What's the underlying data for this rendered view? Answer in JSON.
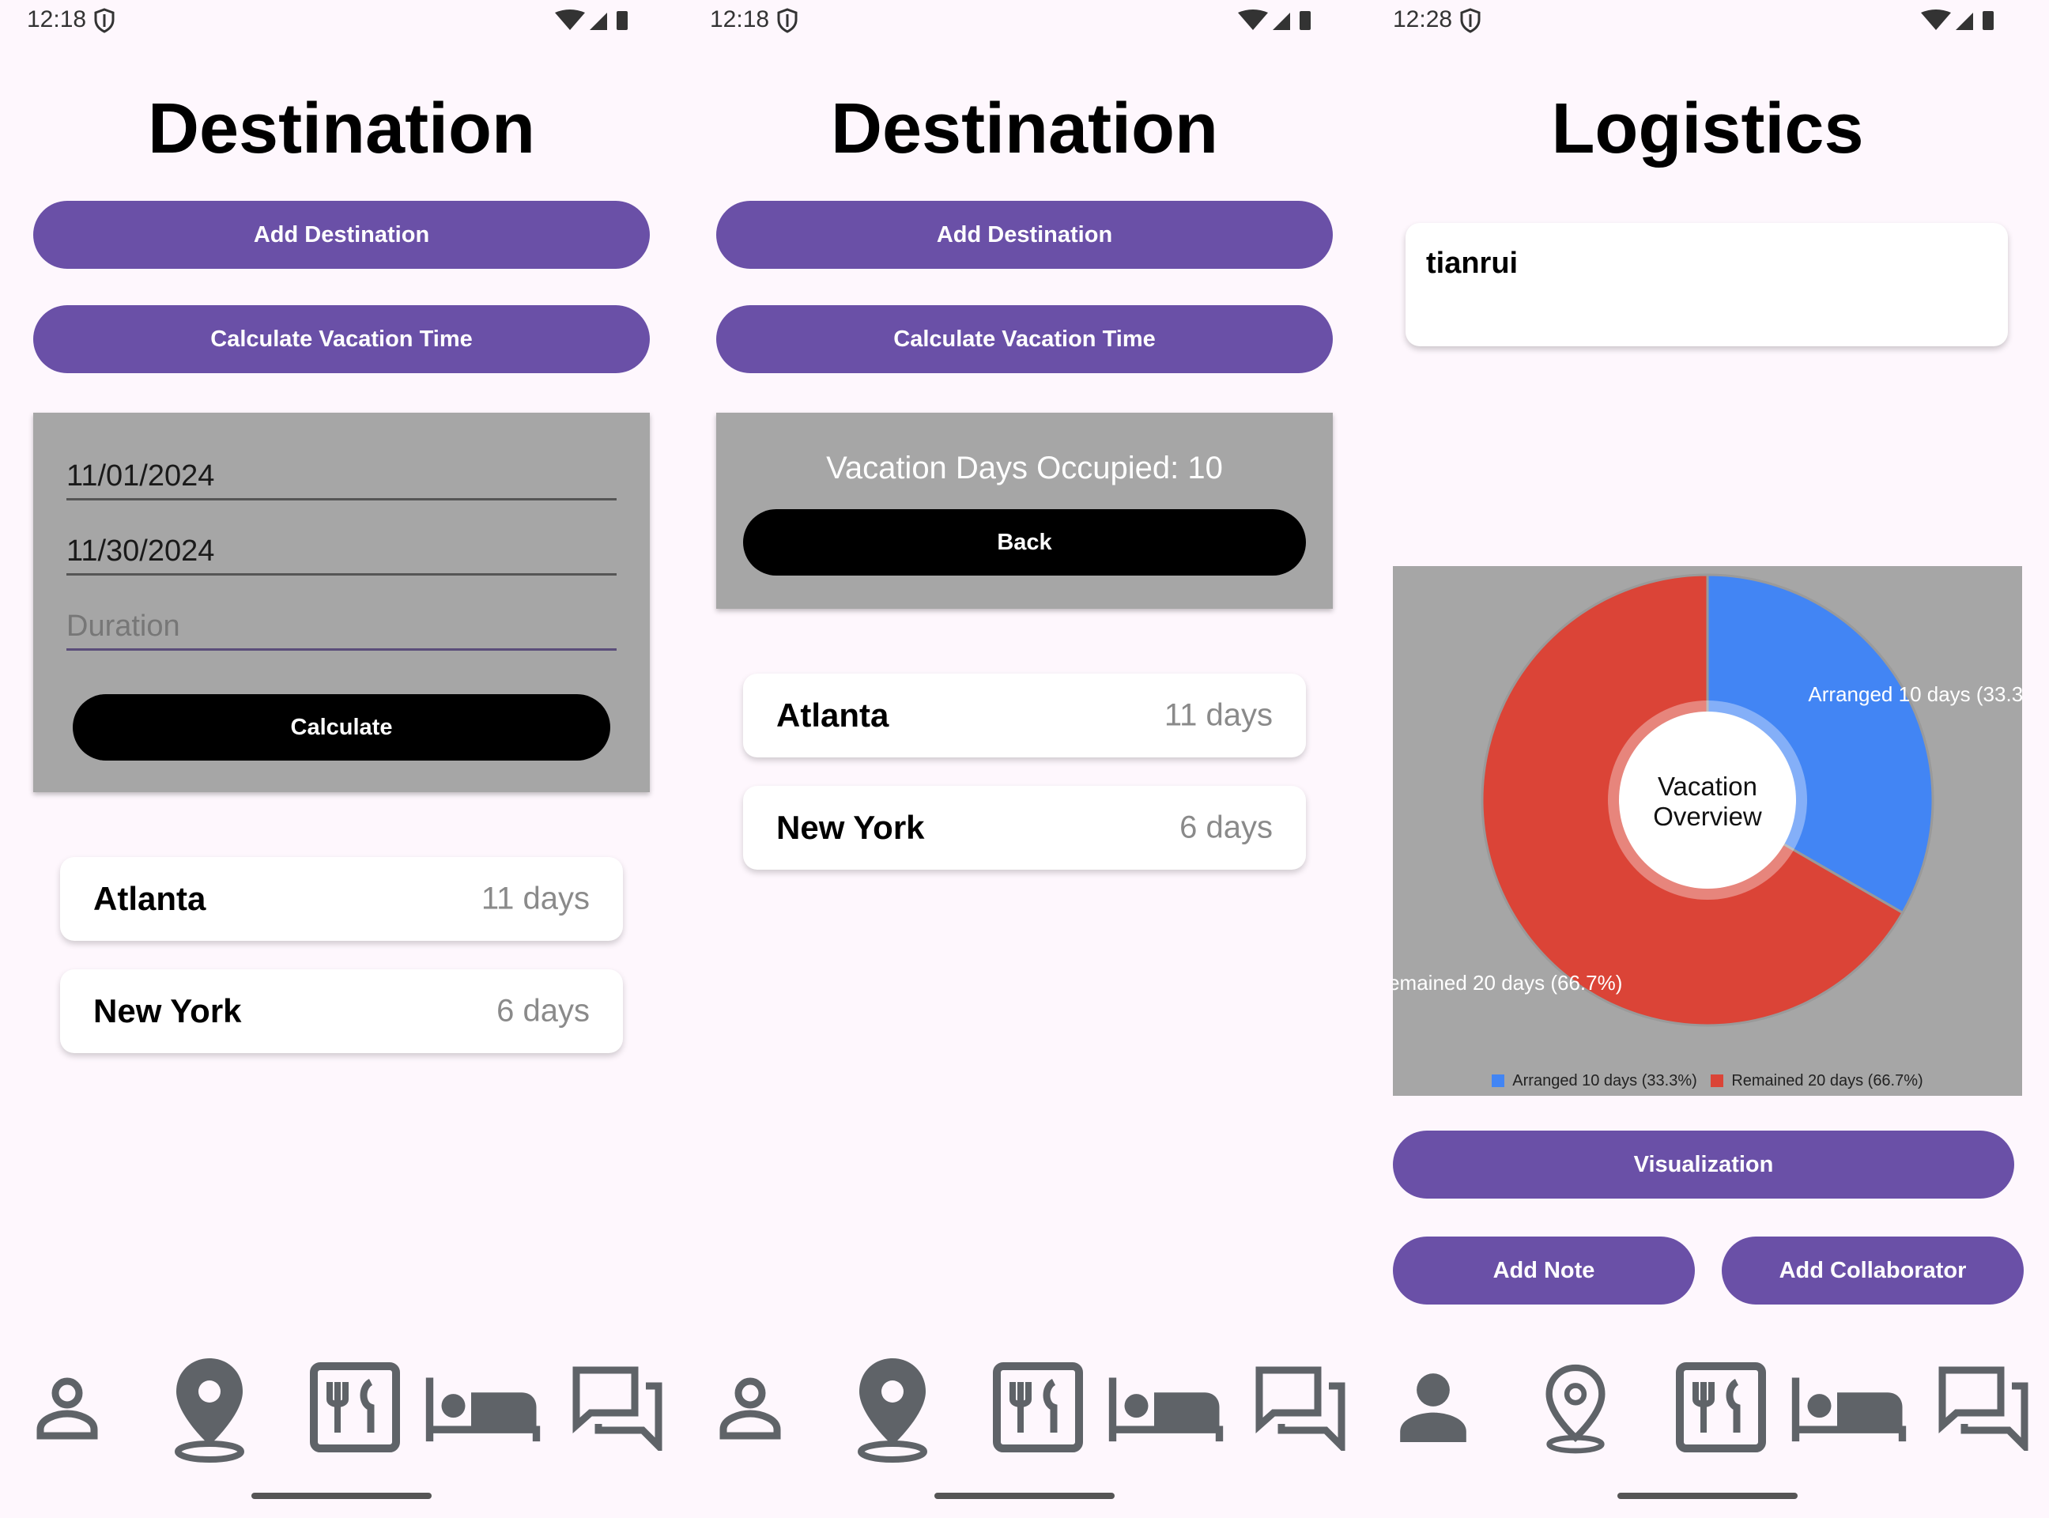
{
  "panels": [
    {
      "status": {
        "time": "12:18"
      },
      "title": "Destination",
      "add_destination": "Add Destination",
      "calculate_vacation_time": "Calculate Vacation Time",
      "form": {
        "start_date": "11/01/2024",
        "end_date": "11/30/2024",
        "duration_placeholder": "Duration",
        "calculate": "Calculate"
      },
      "destinations": [
        {
          "name": "Atlanta",
          "days": "11 days"
        },
        {
          "name": "New York",
          "days": "6 days"
        }
      ]
    },
    {
      "status": {
        "time": "12:18"
      },
      "title": "Destination",
      "add_destination": "Add Destination",
      "calculate_vacation_time": "Calculate Vacation Time",
      "result": {
        "text": "Vacation Days Occupied: 10",
        "back": "Back"
      },
      "destinations": [
        {
          "name": "Atlanta",
          "days": "11 days"
        },
        {
          "name": "New York",
          "days": "6 days"
        }
      ]
    },
    {
      "status": {
        "time": "12:28"
      },
      "title": "Logistics",
      "note_text": "tianrui",
      "visualization": "Visualization",
      "add_note": "Add Note",
      "add_collaborator": "Add Collaborator"
    }
  ],
  "nav": {
    "icons": [
      "person-icon",
      "location-pin-icon",
      "restaurant-icon",
      "hotel-bed-icon",
      "chat-icon"
    ]
  },
  "chart_data": {
    "type": "pie",
    "center_label_line1": "Vacation",
    "center_label_line2": "Overview",
    "slices": [
      {
        "label": "Arranged 10 days (33.3%)",
        "value": 10,
        "percent": 33.3,
        "color": "#4285f4"
      },
      {
        "label": "Remained 20 days (66.7%)",
        "value": 20,
        "percent": 66.7,
        "color": "#db4437"
      }
    ],
    "legend_position": "bottom"
  },
  "colors": {
    "primary": "#6a50a7",
    "background": "#fef7fd",
    "card_grey": "#a6a6a6"
  }
}
